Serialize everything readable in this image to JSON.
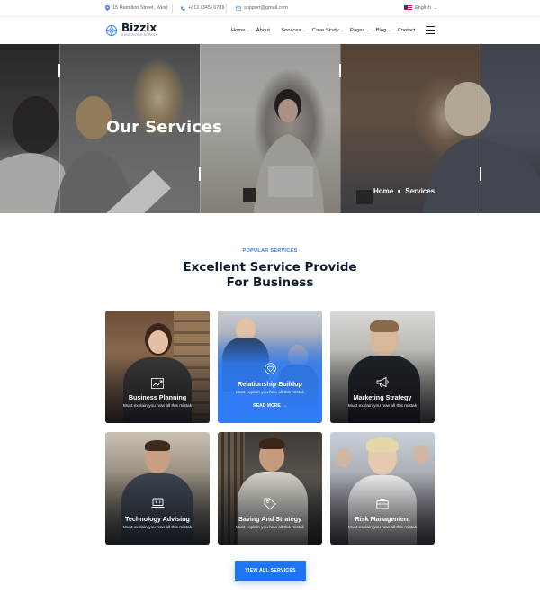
{
  "topbar": {
    "address": "15 Hamilton Street, West",
    "phone": "+812 (345) 6789",
    "email": "support@gmail.com",
    "language": "English",
    "language_icon": "us-flag-icon"
  },
  "header": {
    "logo_name": "Bizzix",
    "logo_tagline": "CONSULTING AGENCY",
    "nav": [
      {
        "label": "Home",
        "has_dropdown": true
      },
      {
        "label": "About",
        "has_dropdown": true
      },
      {
        "label": "Services",
        "has_dropdown": true
      },
      {
        "label": "Case Study",
        "has_dropdown": true
      },
      {
        "label": "Pages",
        "has_dropdown": true
      },
      {
        "label": "Blog",
        "has_dropdown": true
      },
      {
        "label": "Contact",
        "has_dropdown": false
      }
    ]
  },
  "hero": {
    "title": "Our Services",
    "breadcrumb": [
      "Home",
      "Services"
    ]
  },
  "section": {
    "eyebrow": "POPULAR SERVICES",
    "title_line1": "Excellent Service Provide",
    "title_line2": "For Business"
  },
  "cards": [
    {
      "title": "Business Planning",
      "desc": "Must explain you how all this mistak",
      "icon": "chart-growth-icon"
    },
    {
      "title": "Relationship Buildup",
      "desc": "Must explain you how all this mistak",
      "icon": "heart-icon",
      "active": true,
      "read_more": "READ MORE"
    },
    {
      "title": "Marketing Strategy",
      "desc": "Must explain you how all this mistak",
      "icon": "megaphone-icon"
    },
    {
      "title": "Technology Advising",
      "desc": "Must explain you how all this mistak",
      "icon": "laptop-icon"
    },
    {
      "title": "Saving And Strategy",
      "desc": "Must explain you how all this mistak",
      "icon": "tag-icon"
    },
    {
      "title": "Risk Management",
      "desc": "Must explain you how all this mistak",
      "icon": "briefcase-icon"
    }
  ],
  "cta": {
    "label": "VIEW ALL SERVICES"
  },
  "colors": {
    "accent": "#2f7cf6",
    "dark": "#0e1b2c"
  }
}
